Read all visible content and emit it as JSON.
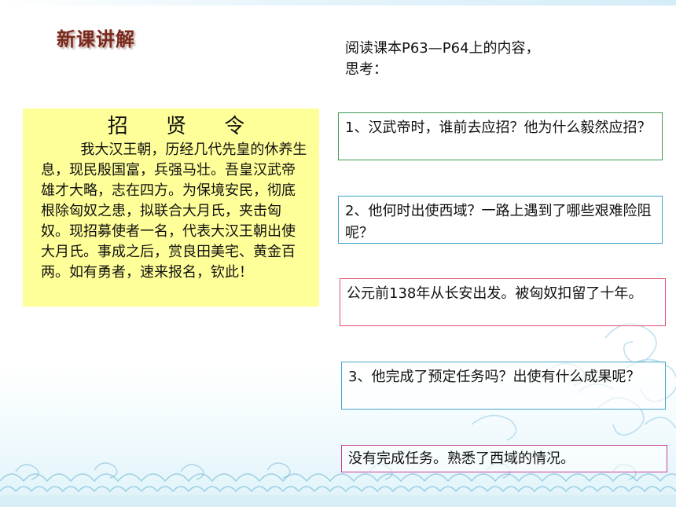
{
  "heading": "新课讲解",
  "intro": "阅读课本P63—P64上的内容，思考：",
  "decree": {
    "title": "招 贤 令",
    "body": "我大汉王朝，历经几代先皇的休养生息，现民殷国富，兵强马壮。吾皇汉武帝雄才大略，志在四方。为保境安民，彻底根除匈奴之患，拟联合大月氏，夹击匈奴。现招募使者一名，代表大汉王朝出使大月氏。事成之后，赏良田美宅、黄金百两。如有勇者，速来报名，钦此！"
  },
  "questions": {
    "q1": "1、汉武帝时，谁前去应招？他为什么毅然应招？",
    "q2": "2、他何时出使西域？一路上遇到了哪些艰难险阻呢？",
    "a2": "公元前138年从长安出发。被匈奴扣留了十年。",
    "q3": "3、他完成了预定任务吗？出使有什么成果呢？",
    "a3": "没有完成任务。熟悉了西域的情况。"
  },
  "colors": {
    "heading": "#7a2a1e",
    "decree_bg": "#ffff99",
    "q1_border": "#3b9c4f",
    "q2_border": "#37a3c9",
    "a2_border": "#e0506c",
    "q3_border": "#4aa3cc",
    "a3_border": "#c8409c",
    "wave_decoration": "#8fc9e0"
  },
  "icons": [
    "wave-pattern-decoration"
  ]
}
